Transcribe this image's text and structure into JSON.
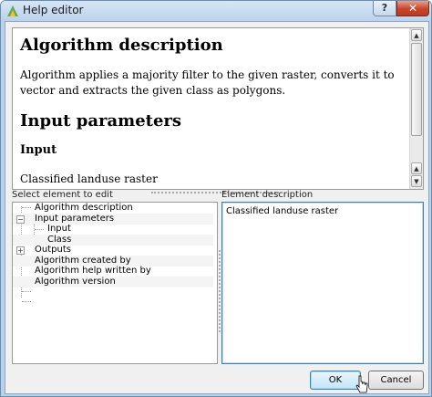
{
  "window": {
    "title": "Help editor",
    "help_label": "?",
    "close_label": "✕"
  },
  "preview": {
    "heading_description": "Algorithm description",
    "description_text": "Algorithm applies a majority filter to the given raster, converts it to vector and extracts the given class as polygons.",
    "heading_params": "Input parameters",
    "heading_input": "Input",
    "input_text": "Classified landuse raster"
  },
  "tree": {
    "label": "Select element to edit",
    "items": [
      {
        "label": "Algorithm description"
      },
      {
        "label": "Input parameters",
        "expanded": true
      },
      {
        "label": "Input"
      },
      {
        "label": "Class"
      },
      {
        "label": "Outputs",
        "expanded": false
      },
      {
        "label": "Algorithm created by"
      },
      {
        "label": "Algorithm help written by"
      },
      {
        "label": "Algorithm version"
      }
    ],
    "expanded_glyph": "−",
    "collapsed_glyph": "+"
  },
  "element_description": {
    "label": "Element description",
    "value": "Classified landuse raster"
  },
  "buttons": {
    "ok": "OK",
    "cancel": "Cancel"
  },
  "icons": {
    "title": "qgis-icon",
    "scroll_up": "scroll-up-arrow-icon",
    "scroll_down": "scroll-down-arrow-icon",
    "cursor": "mouse-cursor-icon"
  },
  "colors": {
    "titlebar": "#bcd2ea",
    "close": "#c9442a",
    "focus_border": "#3c7fb1"
  }
}
